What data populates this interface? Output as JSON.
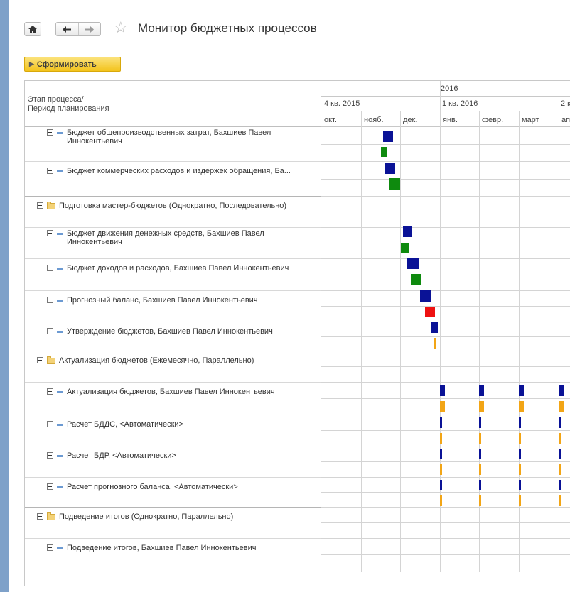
{
  "header": {
    "title": "Монитор бюджетных процессов",
    "generate_label": "Сформировать"
  },
  "tree": {
    "header_label_line1": "Этап процесса/",
    "header_label_line2": "Период планирования",
    "items": [
      {
        "level": 2,
        "kind": "task",
        "label": "Бюджет общепроизводственных затрат, Бахшиев Павел Иннокентьевич",
        "two_line": true
      },
      {
        "level": 2,
        "kind": "task",
        "label": "Бюджет коммерческих расходов и издержек обращения, Ба..."
      },
      {
        "level": 1,
        "kind": "group",
        "label": "Подготовка мастер-бюджетов (Однократно, Последовательно)"
      },
      {
        "level": 2,
        "kind": "task",
        "label": "Бюджет движения денежных средств, Бахшиев Павел Иннокентьевич",
        "two_line": true
      },
      {
        "level": 2,
        "kind": "task",
        "label": "Бюджет доходов и расходов, Бахшиев Павел Иннокентьевич"
      },
      {
        "level": 2,
        "kind": "task",
        "label": "Прогнозный баланс, Бахшиев Павел Иннокентьевич"
      },
      {
        "level": 2,
        "kind": "task",
        "label": "Утверждение бюджетов, Бахшиев Павел Иннокентьевич"
      },
      {
        "level": 1,
        "kind": "group",
        "label": "Актуализация бюджетов (Ежемесячно, Параллельно)"
      },
      {
        "level": 2,
        "kind": "task",
        "label": "Актуализация бюджетов, Бахшиев Павел Иннокентьевич"
      },
      {
        "level": 2,
        "kind": "task",
        "label": "Расчет БДДС, <Автоматически>"
      },
      {
        "level": 2,
        "kind": "task",
        "label": "Расчет БДР, <Автоматически>"
      },
      {
        "level": 2,
        "kind": "task",
        "label": "Расчет прогнозного баланса, <Автоматически>"
      },
      {
        "level": 1,
        "kind": "group",
        "label": "Подведение итогов (Однократно, Параллельно)"
      },
      {
        "level": 2,
        "kind": "task",
        "label": "Подведение итогов, Бахшиев Павел Иннокентьевич"
      }
    ]
  },
  "gantt": {
    "year_label": "2016",
    "quarters": [
      "4 кв. 2015",
      "1 кв. 2016",
      "2 к"
    ],
    "months": [
      "окт.",
      "нояб.",
      "дек.",
      "янв.",
      "февр.",
      "март",
      "апр"
    ]
  },
  "colors": {
    "plan": "#0a1296",
    "fact_green": "#0e8a0e",
    "fact_red": "#ee1111",
    "fact_orange": "#f2a516"
  }
}
